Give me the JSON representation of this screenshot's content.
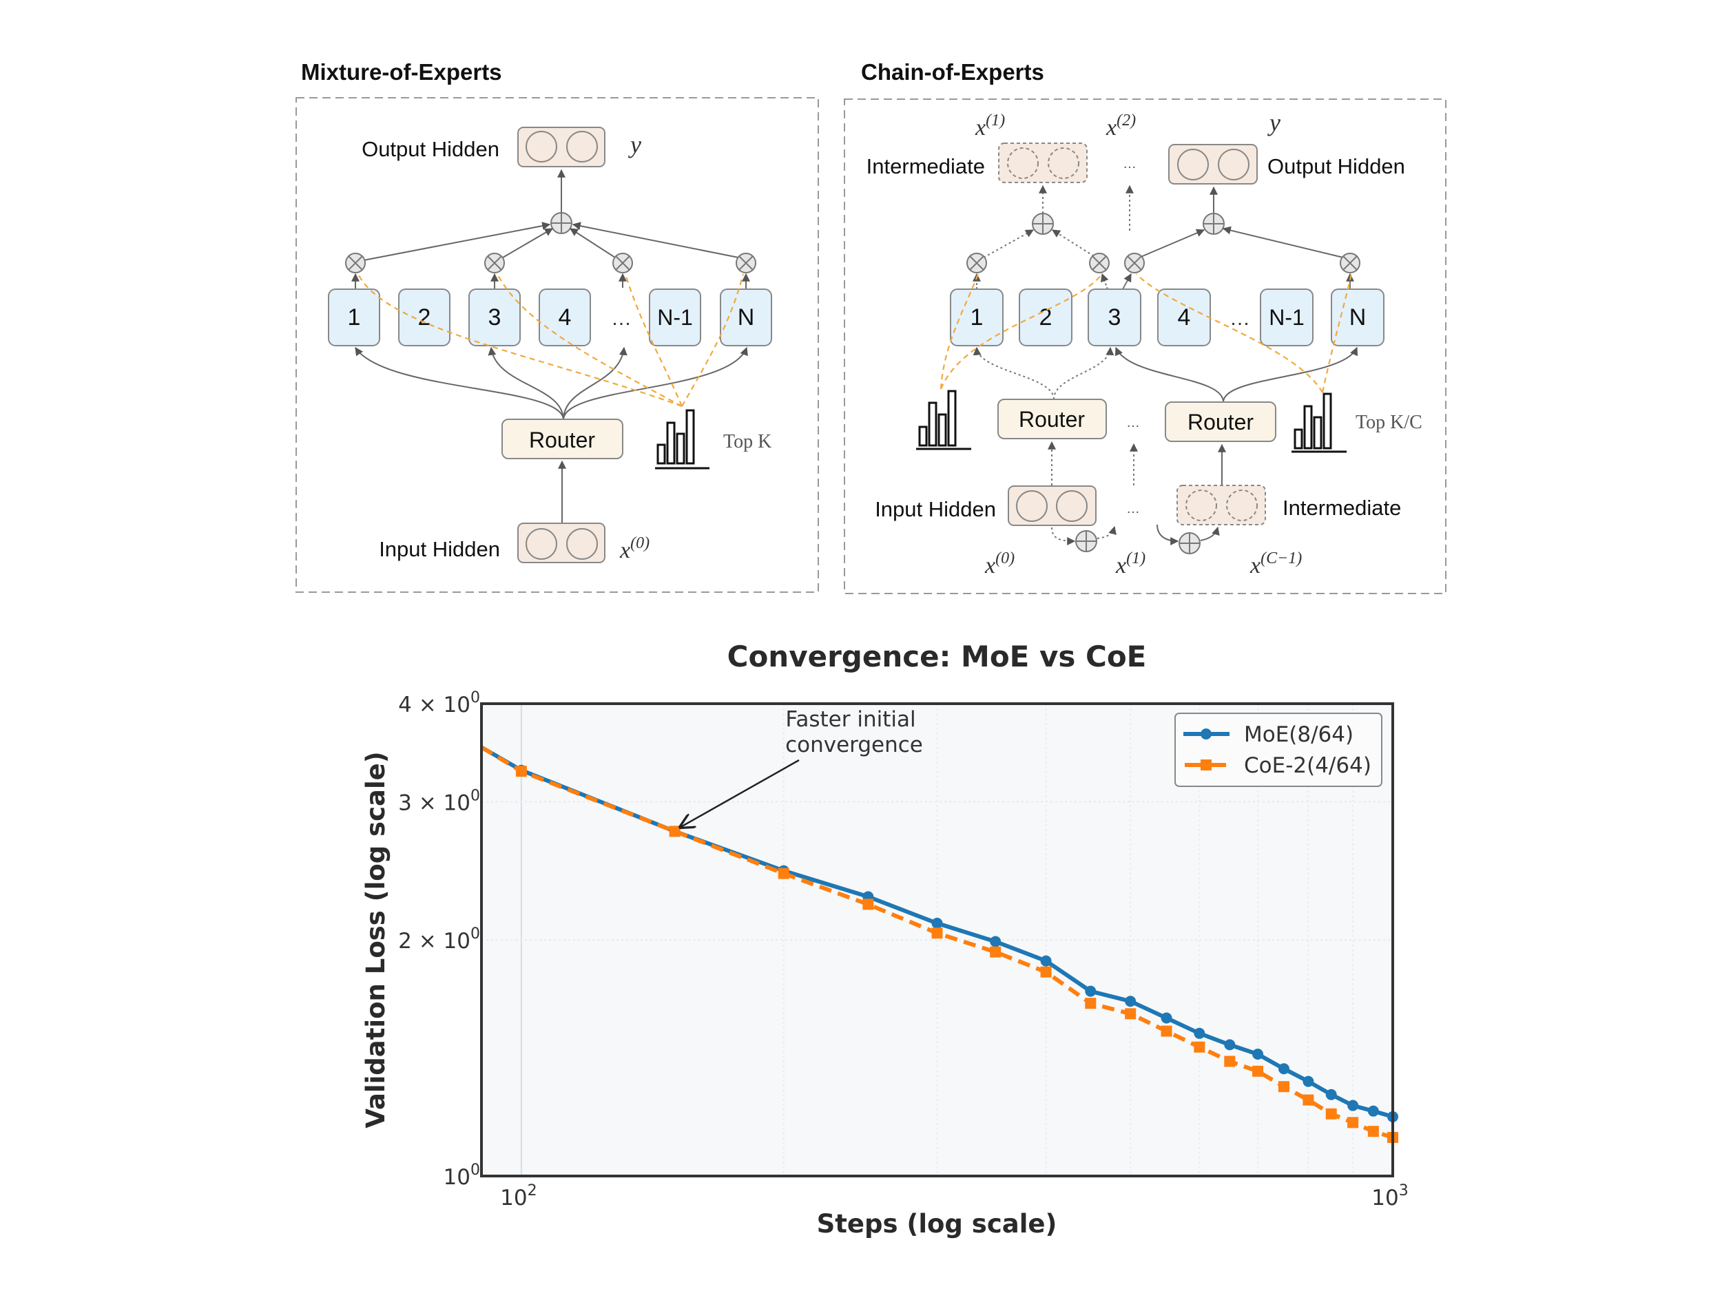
{
  "moe": {
    "title": "Mixture-of-Experts",
    "output_label": "Output Hidden",
    "output_var": "y",
    "input_label": "Input Hidden",
    "input_var": "x",
    "input_sup": "(0)",
    "router_label": "Router",
    "topk_label": "Top K",
    "experts": [
      "1",
      "2",
      "3",
      "4",
      "…",
      "N-1",
      "N"
    ]
  },
  "coe": {
    "title": "Chain-of-Experts",
    "top_vars": [
      {
        "var": "x",
        "sup": "(1)"
      },
      {
        "var": "x",
        "sup": "(2)"
      },
      {
        "var": "y",
        "sup": ""
      }
    ],
    "intermediate_top_label": "Intermediate",
    "output_label": "Output Hidden",
    "ellipsis": "…",
    "experts": [
      "1",
      "2",
      "3",
      "4",
      "…",
      "N-1",
      "N"
    ],
    "router_label": "Router",
    "topk_label": "Top K/C",
    "input_label": "Input Hidden",
    "intermediate_bottom_label": "Intermediate",
    "bottom_vars": [
      {
        "var": "x",
        "sup": "(0)"
      },
      {
        "var": "x",
        "sup": "(1)"
      },
      {
        "var": "x",
        "sup": "(C−1)"
      }
    ]
  },
  "colors": {
    "expert_fill": "#e3f1fb",
    "router_fill": "#fbf4e6",
    "hidden_fill": "#f6e9df",
    "topk_dash": "#f2a93b",
    "moe_series": "#1f77b4",
    "coe_series": "#ff7f0e"
  },
  "chart_data": {
    "type": "line",
    "title": "Convergence: MoE vs CoE",
    "xlabel": "Steps (log scale)",
    "ylabel": "Validation Loss (log scale)",
    "xscale": "log",
    "yscale": "log",
    "xlim": [
      90,
      1000
    ],
    "ylim": [
      1.0,
      4.0
    ],
    "xticks": [
      {
        "value": 100,
        "label": "10",
        "sup": "2"
      },
      {
        "value": 1000,
        "label": "10",
        "sup": "3"
      }
    ],
    "yticks": [
      {
        "value": 4,
        "label": "4 × 10",
        "sup": "0"
      },
      {
        "value": 3,
        "label": "3 × 10",
        "sup": "0"
      },
      {
        "value": 2,
        "label": "2 × 10",
        "sup": "0"
      },
      {
        "value": 1,
        "label": "10",
        "sup": "0"
      }
    ],
    "grid": true,
    "legend_position": "top-right",
    "annotation": {
      "text_lines": [
        "Faster initial",
        "convergence"
      ],
      "x": 150,
      "y": 2.75
    },
    "series": [
      {
        "name": "MoE(8/64)",
        "style": "solid",
        "marker": "circle",
        "x": [
          90,
          100,
          150,
          200,
          250,
          300,
          350,
          400,
          450,
          500,
          550,
          600,
          650,
          700,
          750,
          800,
          850,
          900,
          950,
          1000
        ],
        "y": [
          3.52,
          3.29,
          2.75,
          2.45,
          2.27,
          2.1,
          1.99,
          1.88,
          1.72,
          1.67,
          1.59,
          1.52,
          1.47,
          1.43,
          1.37,
          1.32,
          1.27,
          1.23,
          1.21,
          1.19
        ]
      },
      {
        "name": "CoE-2(4/64)",
        "style": "dashed",
        "marker": "square",
        "x": [
          90,
          100,
          150,
          200,
          250,
          300,
          350,
          400,
          450,
          500,
          550,
          600,
          650,
          700,
          750,
          800,
          850,
          900,
          950,
          1000
        ],
        "y": [
          3.52,
          3.28,
          2.75,
          2.43,
          2.22,
          2.04,
          1.93,
          1.82,
          1.66,
          1.61,
          1.53,
          1.46,
          1.4,
          1.36,
          1.3,
          1.25,
          1.2,
          1.17,
          1.14,
          1.12
        ]
      }
    ]
  }
}
